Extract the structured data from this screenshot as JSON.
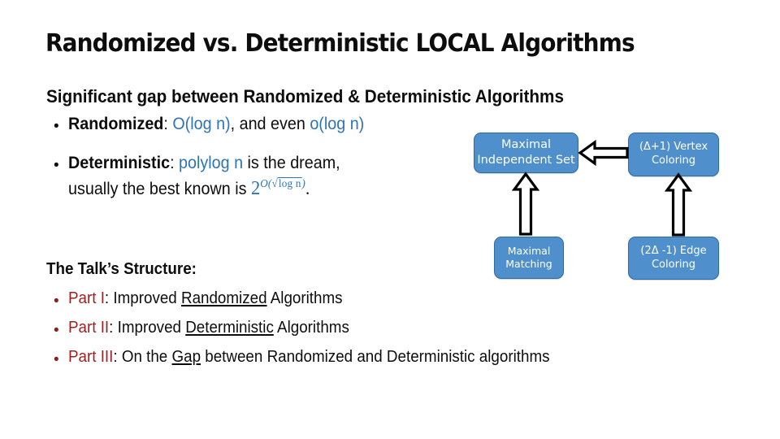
{
  "slide": {
    "title": "Randomized vs. Deterministic LOCAL Algorithms",
    "background_color": "#ffffff"
  },
  "colors": {
    "title_text": "#0d0d0d",
    "body_text": "#0d0d0d",
    "accent_blue": "#2e75b6",
    "accent_red": "#9b2222",
    "box_fill": "#4f8fcc",
    "box_border": "#2f6ba3",
    "box_text": "#ffffff",
    "arrow_fill": "#ffffff",
    "arrow_stroke": "#000000"
  },
  "body": {
    "heading": "Significant gap between Randomized & Deterministic Algorithms",
    "bullet_glyph": "•",
    "randomized": {
      "label": "Randomized",
      "colon": ": ",
      "term1": "O(log n)",
      "middle": ", and even ",
      "term2": "o(log n)"
    },
    "deterministic": {
      "label": "Deterministic",
      "colon": ": ",
      "term": "polylog n",
      "rest": " is the dream,",
      "line2_prefix": "usually the best known is ",
      "formula_base": "2",
      "formula_sup_open": "O(",
      "formula_radical": "√",
      "formula_radicand": "log n",
      "formula_sup_close": ")",
      "formula_period": "."
    },
    "structure_heading": "The Talk’s Structure:",
    "parts": [
      {
        "label": "Part I",
        "colon": ": ",
        "pre": "Improved ",
        "underlined": "Randomized",
        "post": " Algorithms"
      },
      {
        "label": "Part II",
        "colon": ": ",
        "pre": "Improved ",
        "underlined": "Deterministic",
        "post": " Algorithms"
      },
      {
        "label": "Part III",
        "colon": ": ",
        "pre": "On the ",
        "underlined": "Gap",
        "post": " between Randomized and Deterministic algorithms"
      }
    ]
  },
  "diagram": {
    "boxes": [
      {
        "id": "mis",
        "line1": "Maximal",
        "line2": "Independent Set"
      },
      {
        "id": "vertex",
        "line1": "(Δ+1) Vertex",
        "line2": "Coloring"
      },
      {
        "id": "matching",
        "line1": "Maximal",
        "line2": "Matching"
      },
      {
        "id": "edge",
        "line1": "(2Δ -1) Edge",
        "line2": "Coloring"
      }
    ],
    "arrows": [
      {
        "id": "vertex-to-mis",
        "direction": "left"
      },
      {
        "id": "matching-to-mis",
        "direction": "up"
      },
      {
        "id": "edge-to-vertex",
        "direction": "up"
      }
    ]
  }
}
